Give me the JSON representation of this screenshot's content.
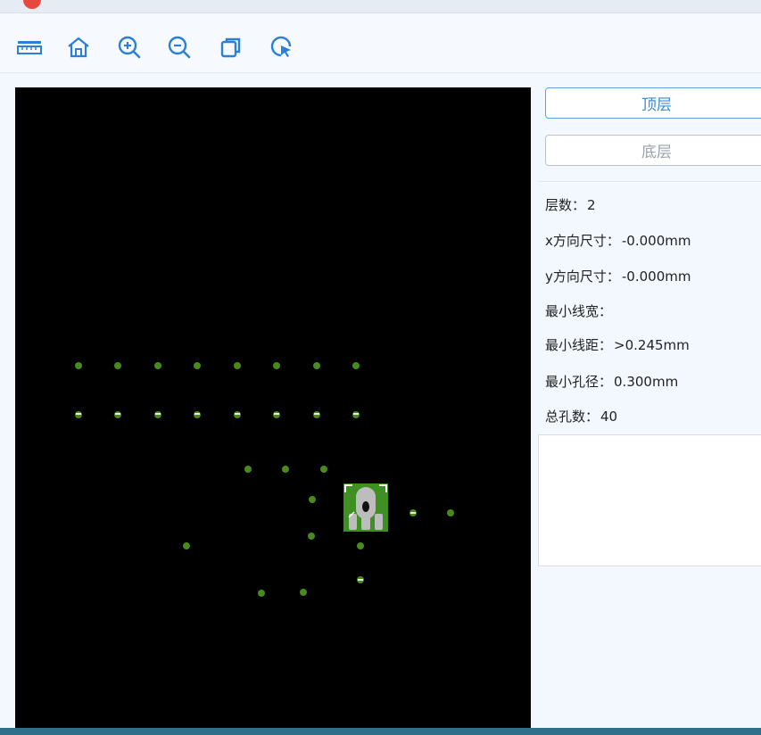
{
  "window": {
    "close_icon": "close-dot-icon",
    "accent": "#e8473e"
  },
  "toolbar": {
    "buttons": [
      {
        "name": "measure",
        "icon": "ruler-icon"
      },
      {
        "name": "home",
        "icon": "home-icon"
      },
      {
        "name": "zoom-in",
        "icon": "zoom-in-icon"
      },
      {
        "name": "zoom-out",
        "icon": "zoom-out-icon"
      },
      {
        "name": "copy",
        "icon": "copy-icon"
      },
      {
        "name": "select",
        "icon": "select-pointer-icon"
      }
    ],
    "icon_color": "#2b7fd4"
  },
  "layers": {
    "top_label": "顶层",
    "bottom_label": "底层",
    "active": "top"
  },
  "info": {
    "layer_count_label": "层数：",
    "layer_count_value": "2",
    "x_size_label": "x方向尺寸：",
    "x_size_value": "-0.000mm",
    "y_size_label": "y方向尺寸：",
    "y_size_value": "-0.000mm",
    "min_trace_width_label": "最小线宽：",
    "min_trace_width_value": "",
    "min_trace_spacing_label": "最小线距：",
    "min_trace_spacing_value": ">0.245mm",
    "min_hole_label": "最小孔径：",
    "min_hole_value": "0.300mm",
    "total_holes_label": "总孔数：",
    "total_holes_value": "40"
  },
  "pcb": {
    "background": "#000000",
    "pad_color": "#4a8a1c",
    "board_green": "#3f8f22"
  }
}
